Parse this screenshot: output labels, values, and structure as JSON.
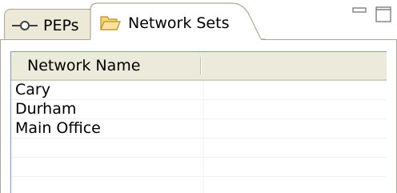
{
  "tabs": [
    {
      "label": "PEPs",
      "icon": "connector-icon",
      "active": false
    },
    {
      "label": "Network Sets",
      "icon": "folder-open-icon",
      "active": true
    }
  ],
  "controls": {
    "minimize_icon": "minimize-icon",
    "maximize_icon": "maximize-icon"
  },
  "table": {
    "columns": [
      "Network Name",
      ""
    ],
    "rows": [
      {
        "name": "Cary"
      },
      {
        "name": "Durham"
      },
      {
        "name": "Main Office"
      },
      {
        "name": ""
      },
      {
        "name": ""
      },
      {
        "name": ""
      }
    ]
  },
  "colors": {
    "border": "#aca899",
    "header_bg": "#ebeadb",
    "inactive_tab_bg": "#ece9d8",
    "folder": "#f5c242"
  }
}
